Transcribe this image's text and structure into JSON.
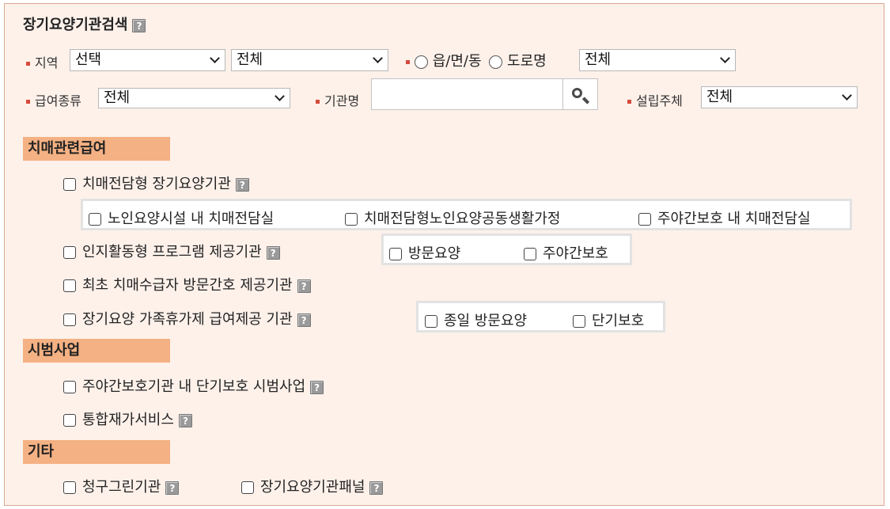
{
  "title": "장기요양기관검색",
  "help_glyph": "?",
  "filters": {
    "region_label": "지역",
    "region_select": "선택",
    "region_sub_select": "전체",
    "radio_1": "읍/면/동",
    "radio_2": "도로명",
    "road_select": "전체",
    "benefit_label": "급여종류",
    "benefit_select": "전체",
    "institution_label": "기관명",
    "institution_value": "",
    "founder_label": "설립주체",
    "founder_select": "전체"
  },
  "sections": {
    "dementia": {
      "title": "치매관련급여",
      "item_1": "치매전담형 장기요양기관",
      "item_1_sub": [
        "노인요양시설 내 치매전담실",
        "치매전담형노인요양공동생활가정",
        "주야간보호 내 치매전담실"
      ],
      "item_2": "인지활동형 프로그램 제공기관",
      "item_2_sub": [
        "방문요양",
        "주야간보호"
      ],
      "item_3": "최초 치매수급자 방문간호 제공기관",
      "item_4": "장기요양 가족휴가제 급여제공 기관",
      "item_4_sub": [
        "종일 방문요양",
        "단기보호"
      ]
    },
    "pilot": {
      "title": "시범사업",
      "item_1": "주야간보호기관 내 단기보호 시범사업",
      "item_2": "통합재가서비스"
    },
    "other": {
      "title": "기타",
      "item_1": "청구그린기관",
      "item_2": "장기요양기관패널"
    }
  },
  "colors": {
    "panel_bg": "#fdf1ea",
    "section_header": "#f4b183",
    "bullet": "#d54a3c"
  }
}
